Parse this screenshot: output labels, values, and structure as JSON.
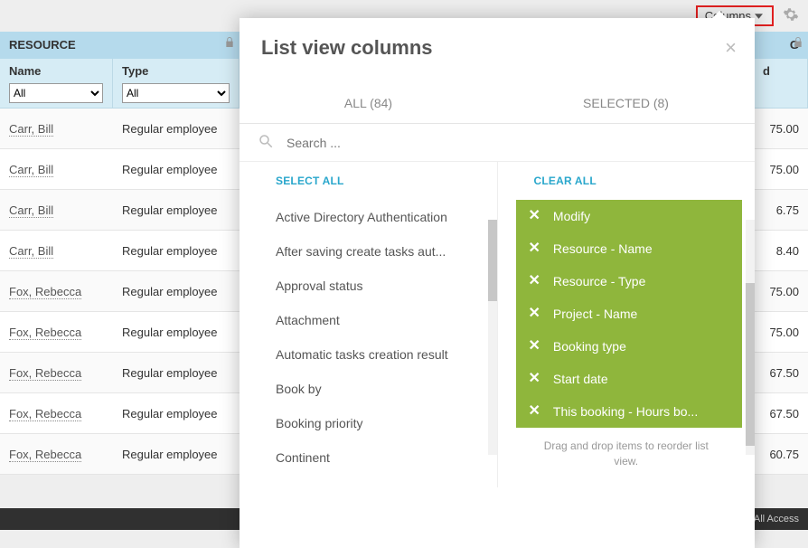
{
  "topbar": {
    "columns_label": "Columns",
    "gear_label": "settings"
  },
  "table": {
    "group_headers": {
      "resource": "RESOURCE",
      "right": "G"
    },
    "columns": {
      "name": "Name",
      "type": "Type",
      "right_suffix": "d"
    },
    "filter_label": "All",
    "rows": [
      {
        "name": "Carr, Bill",
        "type": "Regular employee",
        "val": "75.00"
      },
      {
        "name": "Carr, Bill",
        "type": "Regular employee",
        "val": "75.00"
      },
      {
        "name": "Carr, Bill",
        "type": "Regular employee",
        "val": "6.75"
      },
      {
        "name": "Carr, Bill",
        "type": "Regular employee",
        "val": "8.40"
      },
      {
        "name": "Fox, Rebecca",
        "type": "Regular employee",
        "val": "75.00"
      },
      {
        "name": "Fox, Rebecca",
        "type": "Regular employee",
        "val": "75.00"
      },
      {
        "name": "Fox, Rebecca",
        "type": "Regular employee",
        "val": "67.50"
      },
      {
        "name": "Fox, Rebecca",
        "type": "Regular employee",
        "val": "67.50"
      },
      {
        "name": "Fox, Rebecca",
        "type": "Regular employee",
        "val": "60.75"
      }
    ]
  },
  "modal": {
    "title": "List view columns",
    "tab_all": "ALL (84)",
    "tab_selected": "SELECTED (8)",
    "search_placeholder": "Search ...",
    "select_all": "SELECT ALL",
    "clear_all": "CLEAR ALL",
    "available": [
      "Active Directory Authentication",
      "After saving create tasks aut...",
      "Approval status",
      "Attachment",
      "Automatic tasks creation result",
      "Book by",
      "Booking priority",
      "Continent"
    ],
    "selected": [
      "Modify",
      "Resource - Name",
      "Resource - Type",
      "Project - Name",
      "Booking type",
      "Start date",
      "This booking - Hours bo..."
    ],
    "drag_hint": "Drag and drop items to reorder list view."
  },
  "footer": {
    "status": "All Access"
  }
}
